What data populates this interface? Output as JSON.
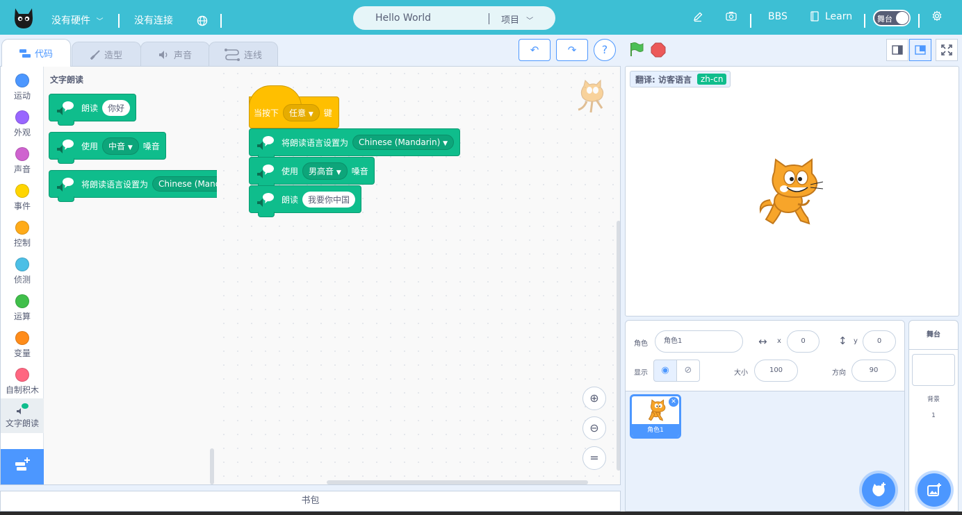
{
  "menu": {
    "hardware": "没有硬件",
    "connection": "没有连接",
    "project_title": "Hello World",
    "project_menu": "项目",
    "bbs": "BBS",
    "learn": "Learn",
    "stage_toggle": "舞台"
  },
  "tabs": [
    {
      "label": "代码"
    },
    {
      "label": "造型"
    },
    {
      "label": "声音"
    },
    {
      "label": "连线"
    }
  ],
  "categories": [
    {
      "label": "运动",
      "color": "#4c97ff"
    },
    {
      "label": "外观",
      "color": "#9966ff"
    },
    {
      "label": "声音",
      "color": "#cf63cf"
    },
    {
      "label": "事件",
      "color": "#ffd500"
    },
    {
      "label": "控制",
      "color": "#ffab19"
    },
    {
      "label": "侦测",
      "color": "#4cbfe6"
    },
    {
      "label": "运算",
      "color": "#40bf4a"
    },
    {
      "label": "变量",
      "color": "#ff8c1a"
    },
    {
      "label": "自制积木",
      "color": "#ff6680"
    },
    {
      "label": "文字朗读",
      "color": "#0fbd8c"
    }
  ],
  "palette": {
    "title": "文字朗读",
    "speak": "朗读",
    "speak_value": "你好",
    "use": "使用",
    "voice_value": "中音",
    "voice_suffix": "嗓音",
    "set_language": "将朗读语言设置为",
    "language_value": "Chinese (Mandarin)"
  },
  "script": {
    "when_key": "当按下",
    "key_value": "任意",
    "key_suffix": "键",
    "set_language": "将朗读语言设置为",
    "language_value": "Chinese (Mandarin)",
    "use": "使用",
    "voice_value": "男高音",
    "voice_suffix": "嗓音",
    "speak": "朗读",
    "speak_value": "我要你中国"
  },
  "backpack": "书包",
  "stage": {
    "monitor_label": "翻译: 访客语言",
    "monitor_value": "zh-cn"
  },
  "sprite_info": {
    "sprite_label": "角色",
    "sprite_name": "角色1",
    "x_label": "x",
    "x_value": "0",
    "y_label": "y",
    "y_value": "0",
    "show_label": "显示",
    "size_label": "大小",
    "size_value": "100",
    "direction_label": "方向",
    "direction_value": "90"
  },
  "sprites": [
    {
      "name": "角色1"
    }
  ],
  "stage_pane": {
    "title": "舞台",
    "backdrops_label": "背景",
    "backdrops_count": "1"
  },
  "colors": {
    "menu_bar": "#3dbfd4",
    "accent": "#4c97ff",
    "tts_block": "#0fbd8c",
    "event_block": "#ffbf00"
  }
}
